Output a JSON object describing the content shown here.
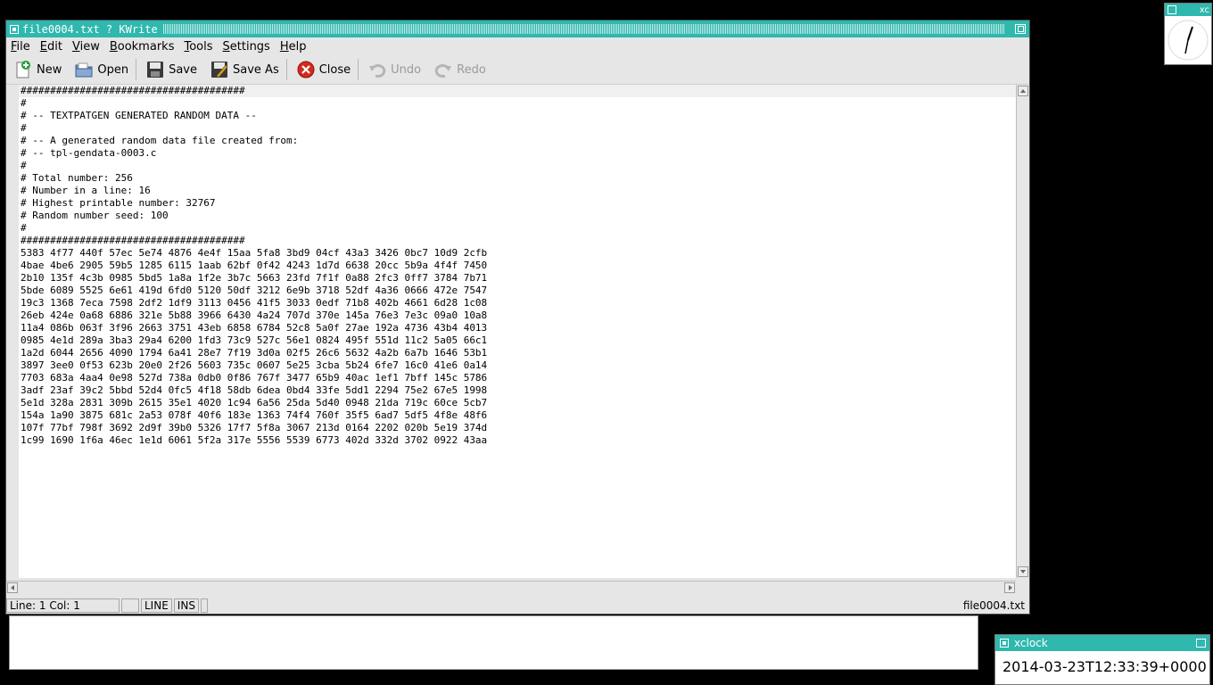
{
  "window": {
    "title": "file0004.txt ? KWrite"
  },
  "menubar": {
    "items": [
      {
        "label": "File",
        "mnemonic": "F",
        "rest": "ile"
      },
      {
        "label": "Edit",
        "mnemonic": "E",
        "rest": "dit"
      },
      {
        "label": "View",
        "mnemonic": "V",
        "rest": "iew"
      },
      {
        "label": "Bookmarks",
        "mnemonic": "B",
        "rest": "ookmarks"
      },
      {
        "label": "Tools",
        "mnemonic": "T",
        "rest": "ools"
      },
      {
        "label": "Settings",
        "mnemonic": "S",
        "rest": "ettings"
      },
      {
        "label": "Help",
        "mnemonic": "H",
        "rest": "elp"
      }
    ]
  },
  "toolbar": {
    "new_label": "New",
    "open_label": "Open",
    "save_label": "Save",
    "save_as_label": "Save As",
    "close_label": "Close",
    "undo_label": "Undo",
    "redo_label": "Redo"
  },
  "editor": {
    "lines": [
      "######################################",
      "#",
      "# -- TEXTPATGEN GENERATED RANDOM DATA --",
      "#",
      "# -- A generated random data file created from:",
      "# -- tpl-gendata-0003.c",
      "#",
      "# Total number: 256",
      "# Number in a line: 16",
      "# Highest printable number: 32767",
      "# Random number seed: 100",
      "#",
      "######################################",
      "5383 4f77 440f 57ec 5e74 4876 4e4f 15aa 5fa8 3bd9 04cf 43a3 3426 0bc7 10d9 2cfb",
      "4bae 4be6 2905 59b5 1285 6115 1aab 62bf 0f42 4243 1d7d 6638 20cc 5b9a 4f4f 7450",
      "2b10 135f 4c3b 0985 5bd5 1a8a 1f2e 3b7c 5663 23fd 7f1f 0a88 2fc3 0ff7 3784 7b71",
      "5bde 6089 5525 6e61 419d 6fd0 5120 50df 3212 6e9b 3718 52df 4a36 0666 472e 7547",
      "19c3 1368 7eca 7598 2df2 1df9 3113 0456 41f5 3033 0edf 71b8 402b 4661 6d28 1c08",
      "26eb 424e 0a68 6886 321e 5b88 3966 6430 4a24 707d 370e 145a 76e3 7e3c 09a0 10a8",
      "11a4 086b 063f 3f96 2663 3751 43eb 6858 6784 52c8 5a0f 27ae 192a 4736 43b4 4013",
      "0985 4e1d 289a 3ba3 29a4 6200 1fd3 73c9 527c 56e1 0824 495f 551d 11c2 5a05 66c1",
      "1a2d 6044 2656 4090 1794 6a41 28e7 7f19 3d0a 02f5 26c6 5632 4a2b 6a7b 1646 53b1",
      "3897 3ee0 0f53 623b 20e0 2f26 5603 735c 0607 5e25 3cba 5b24 6fe7 16c0 41e6 0a14",
      "7703 683a 4aa4 0e98 527d 738a 0db0 0f86 767f 3477 65b9 40ac 1ef1 7bff 145c 5786",
      "3adf 23af 39c2 5bbd 52d4 0fc5 4f18 58db 6dea 0bd4 33fe 5dd1 2294 75e2 67e5 1998",
      "5e1d 328a 2831 309b 2615 35e1 4020 1c94 6a56 25da 5d40 0948 21da 719c 60ce 5cb7",
      "154a 1a90 3875 681c 2a53 078f 40f6 183e 1363 74f4 760f 35f5 6ad7 5df5 4f8e 48f6",
      "107f 77bf 798f 3692 2d9f 39b0 5326 17f7 5f8a 3067 213d 0164 2202 020b 5e19 374d",
      "1c99 1690 1f6a 46ec 1e1d 6061 5f2a 317e 5556 5539 6773 402d 332d 3702 0922 43aa"
    ]
  },
  "statusbar": {
    "position": "Line: 1 Col: 1",
    "mode": "LINE",
    "insert": "INS",
    "filename": "file0004.txt"
  },
  "clock": {
    "title": "xclock",
    "time": "2014-03-23T12:33:39+0000",
    "mini_title": "xc"
  },
  "colors": {
    "titlebar": "#2fb8ae",
    "window_bg": "#e6e6e6",
    "editor_bg": "#ffffff",
    "desktop": "#000000"
  }
}
